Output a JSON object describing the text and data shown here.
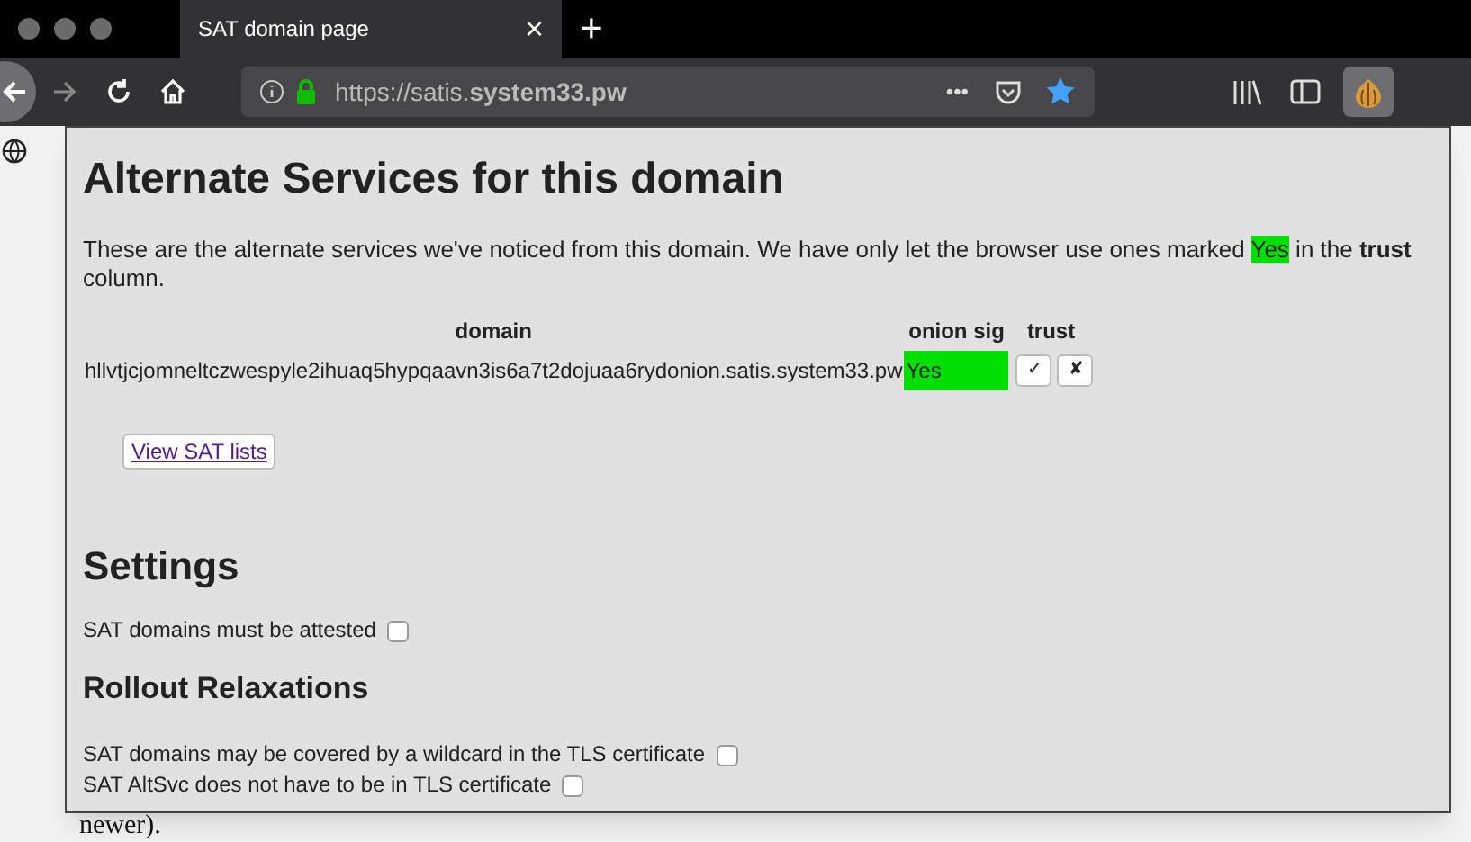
{
  "tab": {
    "title": "SAT domain page",
    "close": "×",
    "new_tab": "+"
  },
  "toolbar": {
    "url": "https://satis.**system33.pw**",
    "more": "•••"
  },
  "panel": {
    "title": "Alternate Services for this domain",
    "intro": [
      {
        "kind": "plain",
        "text": "These are the alternate services we've noticed from this domain. We have only let the browser use ones marked "
      },
      {
        "kind": "highlight",
        "text": "Yes"
      },
      {
        "kind": "plain",
        "text": " in the **trust** column."
      }
    ],
    "table": {
      "columns": [
        "domain",
        "onion sig",
        "trust"
      ],
      "rows": [
        {
          "domain": "hllvtjcjomneltczwespyle2ihuaq5hypqaavn3is6a7t2dojuaa6rydonion.satis.system33.pw",
          "onion_sig": "Yes",
          "verified": true,
          "trust_buttons": [
            "✓",
            "✘"
          ]
        }
      ]
    },
    "view_button": "View SAT lists",
    "settings_title": "Settings",
    "settings": [
      {
        "label": "SAT domains must be attested",
        "checked": false
      }
    ],
    "relax_title": "Rollout Relaxations",
    "relaxations": [
      {
        "label": "SAT domains may be covered by a wildcard in the TLS certificate",
        "checked": false
      },
      {
        "label": "SAT AltSvc does not have to be in TLS certificate",
        "checked": false
      }
    ]
  },
  "page_text": "newer)."
}
